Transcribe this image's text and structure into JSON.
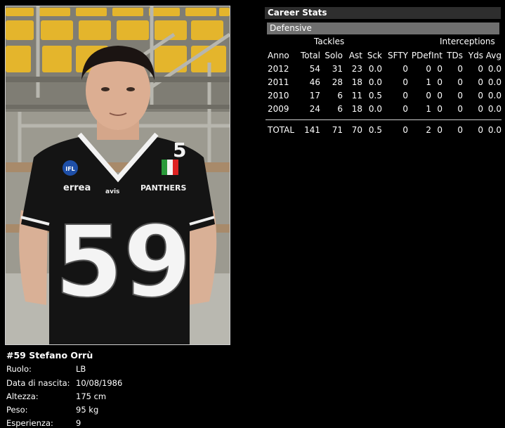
{
  "player": {
    "name": "#59 Stefano Orrù",
    "fields": [
      {
        "label": "Ruolo:",
        "value": "LB"
      },
      {
        "label": "Data di nascita:",
        "value": "10/08/1986"
      },
      {
        "label": "Altezza:",
        "value": "175 cm"
      },
      {
        "label": "Peso:",
        "value": "95 kg"
      },
      {
        "label": "Esperienza:",
        "value": "9"
      }
    ],
    "jersey_number": "59",
    "jersey_small_number": "5",
    "jersey_sponsors": [
      "errea",
      "avis",
      "PANTHERS"
    ],
    "jersey_league_logo": "IFL"
  },
  "stats": {
    "title": "Career Stats",
    "section": "Defensive",
    "groups": {
      "tackles": "Tackles",
      "interceptions": "Interceptions"
    },
    "columns": [
      "Anno",
      "Total",
      "Solo",
      "Ast",
      "Sck",
      "SFTY",
      "PDef",
      "Int",
      "TDs",
      "Yds",
      "Avg"
    ],
    "rows": [
      [
        "2012",
        "54",
        "31",
        "23",
        "0.0",
        "0",
        "0",
        "0",
        "0",
        "0",
        "0.0"
      ],
      [
        "2011",
        "46",
        "28",
        "18",
        "0.0",
        "0",
        "1",
        "0",
        "0",
        "0",
        "0.0"
      ],
      [
        "2010",
        "17",
        "6",
        "11",
        "0.5",
        "0",
        "0",
        "0",
        "0",
        "0",
        "0.0"
      ],
      [
        "2009",
        "24",
        "6",
        "18",
        "0.0",
        "0",
        "1",
        "0",
        "0",
        "0",
        "0.0"
      ]
    ],
    "total": [
      "TOTAL",
      "141",
      "71",
      "70",
      "0.5",
      "0",
      "2",
      "0",
      "0",
      "0",
      "0.0"
    ]
  },
  "colors": {
    "background": "#000000",
    "header_bar": "#2e2e2e",
    "subheader_bar": "#6f6f6f",
    "text": "#ffffff",
    "seat_yellow": "#e8b830"
  }
}
